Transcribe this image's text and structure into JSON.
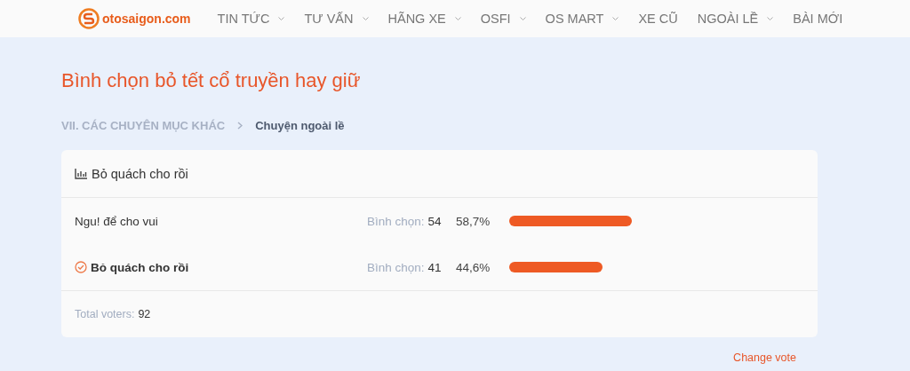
{
  "header": {
    "logo_text": "otosaigon.com",
    "nav": [
      {
        "label": "TIN TỨC",
        "has_dropdown": true
      },
      {
        "label": "TƯ VẤN",
        "has_dropdown": true
      },
      {
        "label": "HÃNG XE",
        "has_dropdown": true
      },
      {
        "label": "OSFI",
        "has_dropdown": true
      },
      {
        "label": "OS MART",
        "has_dropdown": true
      },
      {
        "label": "XE CŨ",
        "has_dropdown": false
      },
      {
        "label": "NGOÀI LỀ",
        "has_dropdown": true
      },
      {
        "label": "BÀI MỚI",
        "has_dropdown": false
      }
    ]
  },
  "page_title": "Bình chọn bỏ tết cổ truyền hay giữ",
  "breadcrumb": [
    "VII. CÁC CHUYÊN MỤC KHÁC",
    "Chuyện ngoài lề"
  ],
  "poll": {
    "question": "Bỏ quách cho rồi",
    "options": [
      {
        "label": "Ngu! để cho vui",
        "selected": false,
        "votes_label": "Bình chọn:",
        "votes": "54",
        "percent": "58,7%"
      },
      {
        "label": "Bỏ quách cho rồi",
        "selected": true,
        "votes_label": "Bình chọn:",
        "votes": "41",
        "percent": "44,6%"
      }
    ],
    "total_label": "Total voters:",
    "total": "92",
    "change_vote": "Change vote"
  }
}
